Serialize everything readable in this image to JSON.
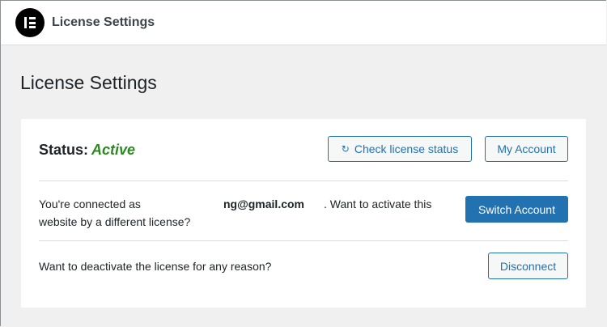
{
  "topbar": {
    "logo_icon": "elementor-logo-icon",
    "title": "License Settings"
  },
  "page": {
    "title": "License Settings"
  },
  "status_row": {
    "label": "Status:",
    "value": "Active",
    "value_color": "#2a8a1f",
    "check_button": {
      "icon": "sync-icon",
      "label": "Check license status"
    },
    "account_button": "My Account"
  },
  "connection_row": {
    "prefix": "You're connected as",
    "email": "ng@gmail.com",
    "suffix": ". Want to activate this",
    "line2": "website by a different license?",
    "switch_button": "Switch Account"
  },
  "disconnect_row": {
    "text": "Want to deactivate the license for any reason?",
    "disconnect_button": "Disconnect"
  },
  "colors": {
    "accent": "#2271b1",
    "background": "#f0f0f1",
    "active": "#2a8a1f"
  }
}
